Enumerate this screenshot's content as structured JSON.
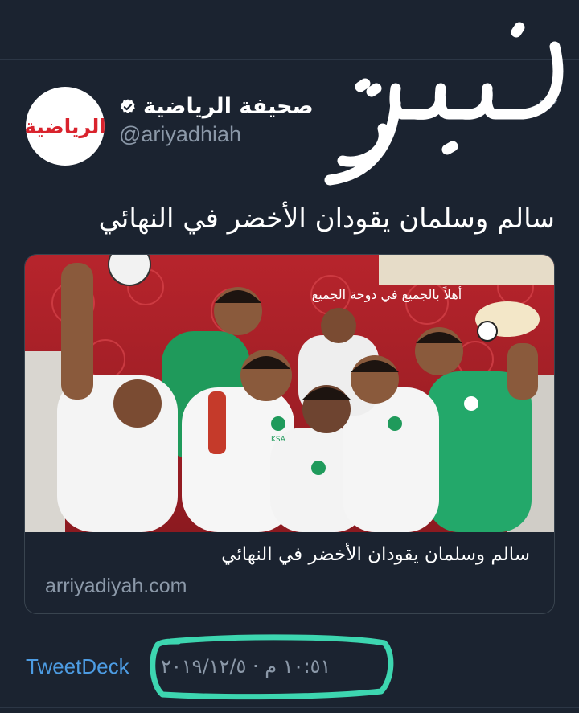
{
  "tweet": {
    "account_name": "صحيفة الرياضية",
    "handle": "@ariyadhiah",
    "avatar_text": "الرياضية",
    "text": "سالم وسلمان يقودان الأخضر في النهائي",
    "handwritten_annotation": "خسرنا",
    "card": {
      "title": "سالم وسلمان يقودان الأخضر في النهائي",
      "domain": "arriyadiyah.com",
      "photo_wall_text": "أهلاً بالجميع في دوحة الجميع",
      "jersey_text": "KSA"
    },
    "source": "TweetDeck",
    "timestamp": "١٠:٥١ م · ٢٠١٩/١٢/٥"
  },
  "icons": {
    "verified": "verified-badge-icon",
    "chevron": "chevron-down-icon"
  },
  "colors": {
    "background": "#1b2330",
    "link_blue": "#4d9ce3",
    "secondary_text": "#8b98a8",
    "annotation_green": "#3dd6b0",
    "logo_red": "#d9232d"
  }
}
